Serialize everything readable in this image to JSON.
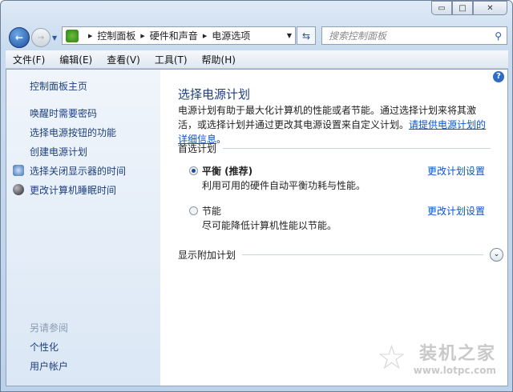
{
  "window": {
    "minimize": "▭",
    "maximize": "□",
    "close": "✕"
  },
  "address": {
    "crumbs": [
      "控制面板",
      "硬件和声音",
      "电源选项"
    ]
  },
  "search": {
    "placeholder": "搜索控制面板"
  },
  "menu": [
    "文件(F)",
    "编辑(E)",
    "查看(V)",
    "工具(T)",
    "帮助(H)"
  ],
  "sidebar": {
    "home": "控制面板主页",
    "links": [
      "唤醒时需要密码",
      "选择电源按钮的功能",
      "创建电源计划",
      "选择关闭显示器的时间",
      "更改计算机睡眠时间"
    ],
    "see_also": "另请参阅",
    "see_also_links": [
      "个性化",
      "用户帐户"
    ]
  },
  "main": {
    "title": "选择电源计划",
    "desc": "电源计划有助于最大化计算机的性能或者节能。通过选择计划来将其激活，或选择计划并通过更改其电源设置来自定义计划。",
    "desc_link": "请提供电源计划的详细信息",
    "desc_end": "。",
    "section": "首选计划",
    "plans": [
      {
        "name": "平衡 (推荐)",
        "desc": "利用可用的硬件自动平衡功耗与性能。",
        "selected": true,
        "change": "更改计划设置"
      },
      {
        "name": "节能",
        "desc": "尽可能降低计算机性能以节能。",
        "selected": false,
        "change": "更改计划设置"
      }
    ],
    "more": "显示附加计划"
  },
  "watermark": {
    "title": "装机之家",
    "url": "www.lotpc.com"
  }
}
